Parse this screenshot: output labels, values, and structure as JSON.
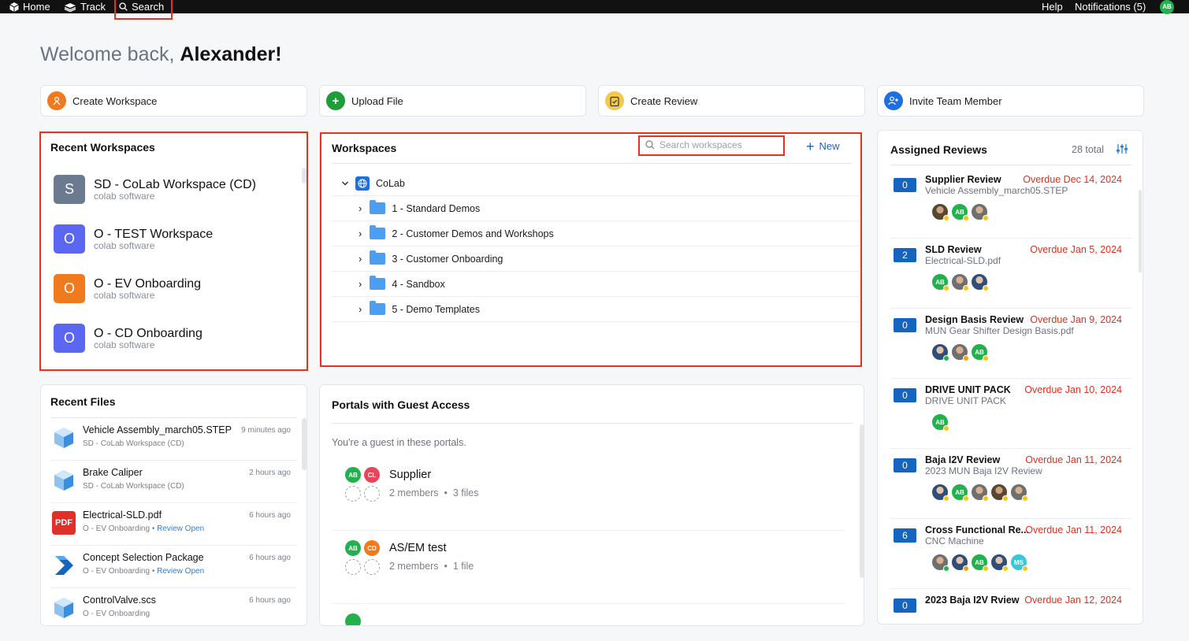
{
  "topbar": {
    "home": "Home",
    "track": "Track",
    "search": "Search",
    "help": "Help",
    "notifications": "Notifications (5)",
    "avatar": "AB"
  },
  "welcome": {
    "prefix": "Welcome back,",
    "name": "Alexander!"
  },
  "quick_actions": [
    {
      "label": "Create Workspace",
      "icon": "person-pin-icon",
      "color": "#f07a1e"
    },
    {
      "label": "Upload File",
      "icon": "plus-icon",
      "color": "#1f9d3a"
    },
    {
      "label": "Create Review",
      "icon": "clipboard-check-icon",
      "color": "#f2c94c"
    },
    {
      "label": "Invite Team Member",
      "icon": "add-person-icon",
      "color": "#1e6fe0"
    }
  ],
  "recent_workspaces": {
    "title": "Recent Workspaces",
    "items": [
      {
        "letter": "S",
        "name": "SD - CoLab Workspace (CD)",
        "sub": "colab software",
        "color": "#6b7a8f"
      },
      {
        "letter": "O",
        "name": "O - TEST Workspace",
        "sub": "colab software",
        "color": "#5b67f0"
      },
      {
        "letter": "O",
        "name": "O - EV Onboarding",
        "sub": "colab software",
        "color": "#f07a1e"
      },
      {
        "letter": "O",
        "name": "O - CD Onboarding",
        "sub": "colab software",
        "color": "#5b67f0"
      }
    ]
  },
  "workspaces": {
    "title": "Workspaces",
    "search_placeholder": "Search workspaces",
    "new_label": "New",
    "root": "CoLab",
    "folders": [
      "1 - Standard Demos",
      "2 - Customer Demos and Workshops",
      "3 - Customer Onboarding",
      "4 - Sandbox",
      "5 - Demo Templates"
    ]
  },
  "recent_files": {
    "title": "Recent Files",
    "items": [
      {
        "name": "Vehicle Assembly_march05.STEP",
        "workspace": "SD - CoLab Workspace (CD)",
        "time": "9 minutes ago",
        "review": "",
        "icon": "cube-icon"
      },
      {
        "name": "Brake Caliper",
        "workspace": "SD - CoLab Workspace (CD)",
        "time": "2 hours ago",
        "review": "",
        "icon": "cube-icon"
      },
      {
        "name": "Electrical-SLD.pdf",
        "workspace": "O - EV Onboarding",
        "time": "6 hours ago",
        "review": "Review Open",
        "icon": "pdf-icon"
      },
      {
        "name": "Concept Selection Package",
        "workspace": "O - EV Onboarding",
        "time": "6 hours ago",
        "review": "Review Open",
        "icon": "chevron-logo-icon"
      },
      {
        "name": "ControlValve.scs",
        "workspace": "O - EV Onboarding",
        "time": "6 hours ago",
        "review": "",
        "icon": "cube-icon"
      }
    ]
  },
  "portals": {
    "title": "Portals with Guest Access",
    "subtitle": "You're a guest in these portals.",
    "items": [
      {
        "name": "Supplier",
        "members": "2 members",
        "files": "3 files",
        "avatars": [
          {
            "t": "AB",
            "c": "#22b14c"
          },
          {
            "t": "CL",
            "c": "#e8455a"
          }
        ]
      },
      {
        "name": "AS/EM test",
        "members": "2 members",
        "files": "1 file",
        "avatars": [
          {
            "t": "AB",
            "c": "#22b14c"
          },
          {
            "t": "CD",
            "c": "#f07a1e"
          }
        ]
      }
    ]
  },
  "reviews": {
    "title": "Assigned Reviews",
    "total": "28 total",
    "items": [
      {
        "count": "0",
        "title": "Supplier Review",
        "due": "Overdue Dec 14, 2024",
        "file": "Vehicle Assembly_march05.STEP"
      },
      {
        "count": "2",
        "title": "SLD Review",
        "due": "Overdue Jan 5, 2024",
        "file": "Electrical-SLD.pdf"
      },
      {
        "count": "0",
        "title": "Design Basis Review",
        "due": "Overdue Jan 9, 2024",
        "file": "MUN Gear Shifter Design Basis.pdf"
      },
      {
        "count": "0",
        "title": "DRIVE UNIT PACK",
        "due": "Overdue Jan 10, 2024",
        "file": "DRIVE UNIT PACK"
      },
      {
        "count": "0",
        "title": "Baja I2V Review",
        "due": "Overdue Jan 11, 2024",
        "file": "2023 MUN Baja I2V Review"
      },
      {
        "count": "6",
        "title": "Cross Functional Re...",
        "due": "Overdue Jan 11, 2024",
        "file": "CNC Machine"
      },
      {
        "count": "0",
        "title": "2023 Baja I2V Rview",
        "due": "Overdue Jan 12, 2024",
        "file": ""
      }
    ],
    "avatar_labels": {
      "ab": "AB",
      "ms": "MS"
    }
  }
}
